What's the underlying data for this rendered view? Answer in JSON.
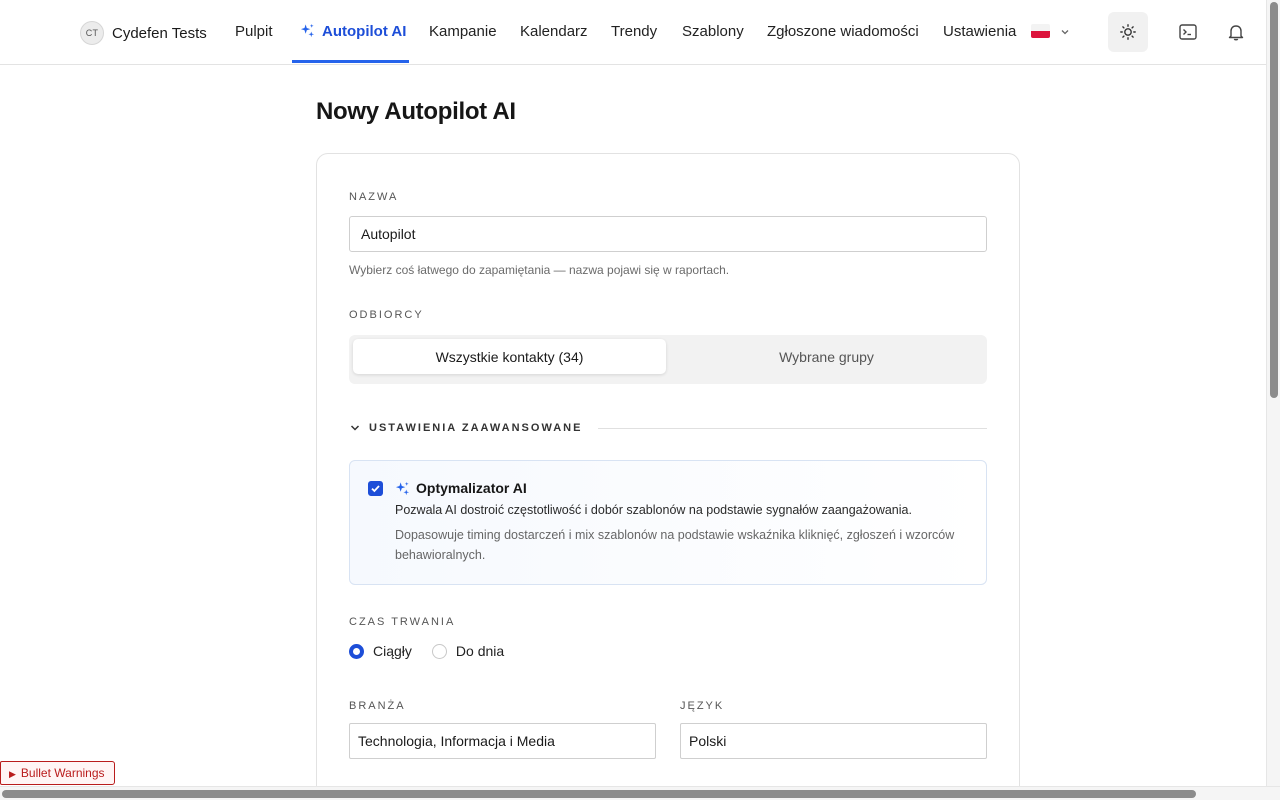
{
  "header": {
    "avatar_initials": "CT",
    "brand_name": "Cydefen Tests",
    "nav": [
      {
        "label": "Pulpit"
      },
      {
        "label": "Autopilot AI",
        "active": true
      },
      {
        "label": "Kampanie"
      },
      {
        "label": "Kalendarz"
      },
      {
        "label": "Trendy"
      },
      {
        "label": "Szablony"
      },
      {
        "label": "Zgłoszone wiadomości"
      },
      {
        "label": "Ustawienia"
      }
    ],
    "language_flag": "pl-flag",
    "accent_color": "#2563eb"
  },
  "page": {
    "title": "Nowy Autopilot AI"
  },
  "form": {
    "name": {
      "label": "NAZWA",
      "value": "Autopilot",
      "hint": "Wybierz coś łatwego do zapamiętania — nazwa pojawi się w raportach."
    },
    "recipients": {
      "label": "ODBIORCY",
      "options": [
        "Wszystkie kontakty (34)",
        "Wybrane grupy"
      ],
      "selected": "Wszystkie kontakty (34)"
    },
    "advanced": {
      "label": "USTAWIENIA ZAAWANSOWANE",
      "expanded": true
    },
    "ai_optimizer": {
      "checked": true,
      "title": "Optymalizator AI",
      "description": "Pozwala AI dostroić częstotliwość i dobór szablonów na podstawie sygnałów zaangażowania.",
      "detail": "Dopasowuje timing dostarczeń i mix szablonów na podstawie wskaźnika kliknięć, zgłoszeń i wzorców behawioralnych."
    },
    "duration": {
      "label": "CZAS TRWANIA",
      "options": [
        "Ciągły",
        "Do dnia"
      ],
      "selected": "Ciągły"
    },
    "industry": {
      "label": "BRANŻA",
      "value": "Technologia, Informacja i Media"
    },
    "language": {
      "label": "JĘZYK",
      "value": "Polski"
    }
  },
  "debug": {
    "warning_label": "Bullet Warnings"
  }
}
